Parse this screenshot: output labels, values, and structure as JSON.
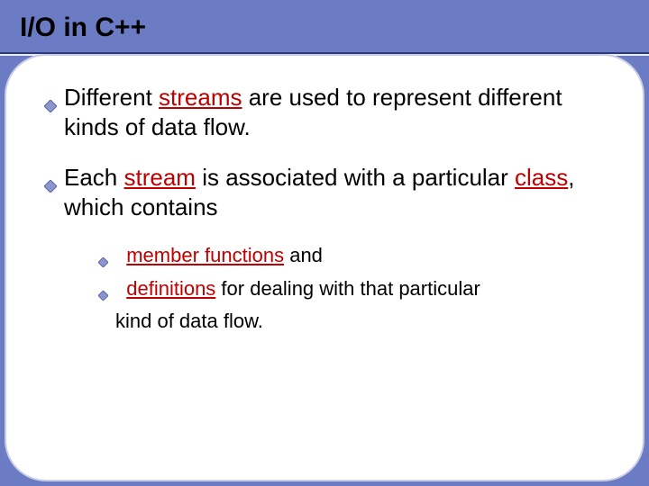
{
  "title": "I/O in C++",
  "bullets": [
    {
      "pre": "Different ",
      "hl1": "streams",
      "mid": " are used to represent different kinds of  data flow.",
      "hl2": "",
      "post": ""
    },
    {
      "pre": "Each ",
      "hl1": "stream",
      "mid": " is associated with a particular ",
      "hl2": "class",
      "post": ", which contains"
    }
  ],
  "sub_bullets": [
    {
      "hl": "member functions",
      "rest": " and"
    },
    {
      "hl": "definitions",
      "rest": " for dealing with that particular"
    }
  ],
  "sub_continue": "kind of data flow.",
  "colors": {
    "accent": "#6b7bc4",
    "diamond_fill": "#8b96cc",
    "diamond_stroke": "#5a68a8",
    "highlight": "#c00000"
  }
}
